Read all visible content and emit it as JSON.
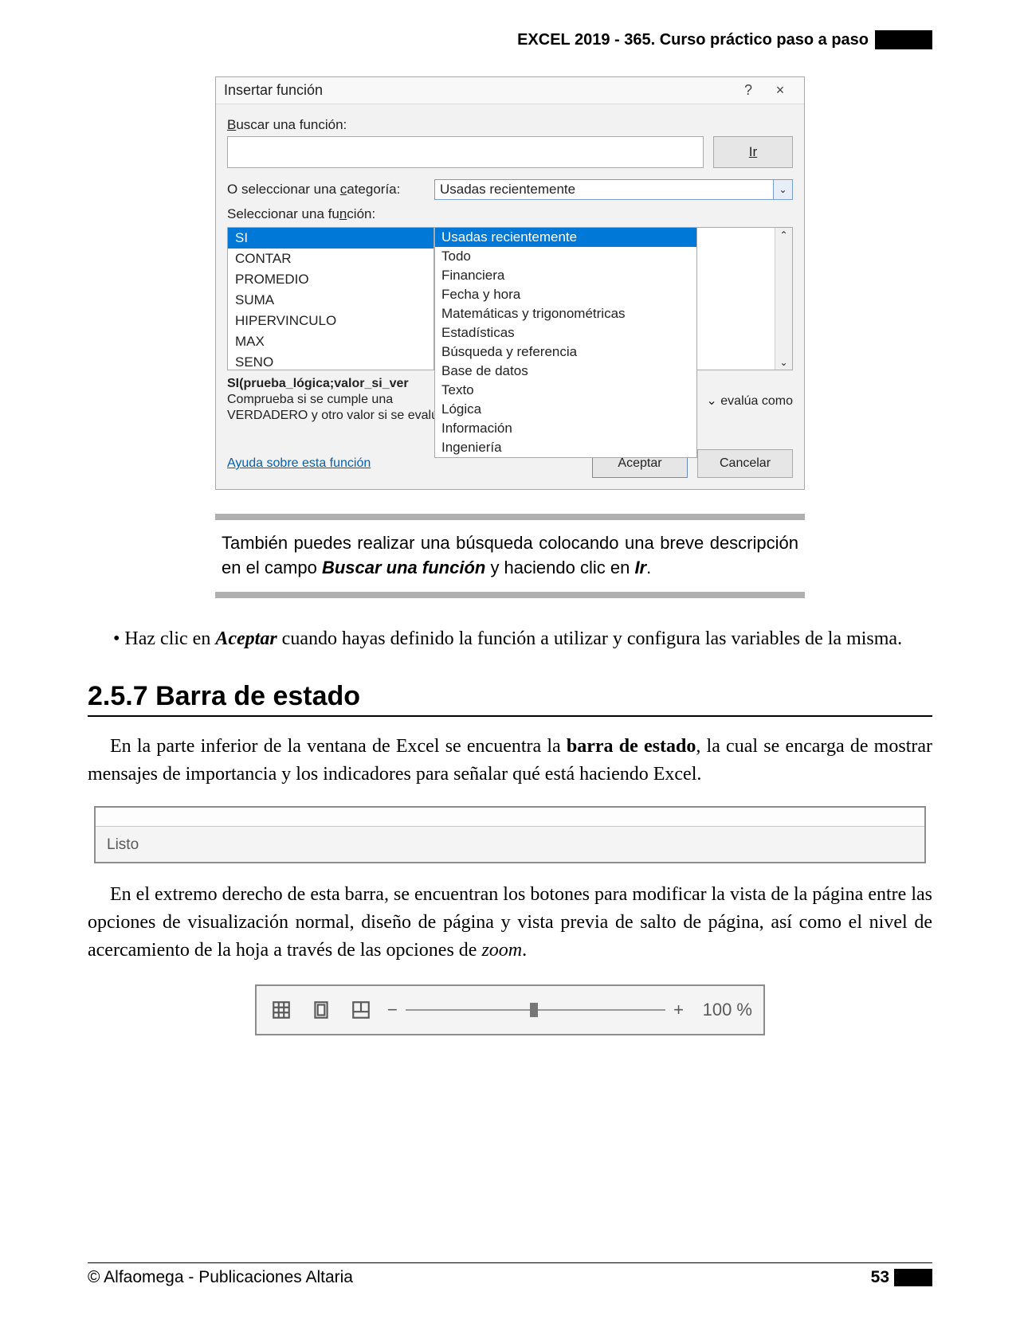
{
  "header": {
    "book_title": "EXCEL 2019 - 365. Curso práctico paso a paso"
  },
  "dialog": {
    "title": "Insertar función",
    "help_icon": "?",
    "close_icon": "×",
    "search_label": "Buscar una función:",
    "go_label": "Ir",
    "cat_label": "O seleccionar una categoría:",
    "cat_value": "Usadas recientemente",
    "dropdown_options": [
      "Usadas recientemente",
      "Todo",
      "Financiera",
      "Fecha y hora",
      "Matemáticas y trigonométricas",
      "Estadísticas",
      "Búsqueda y referencia",
      "Base de datos",
      "Texto",
      "Lógica",
      "Información",
      "Ingeniería"
    ],
    "func_label": "Seleccionar una función:",
    "func_list": [
      "SI",
      "CONTAR",
      "PROMEDIO",
      "SUMA",
      "HIPERVINCULO",
      "MAX",
      "SENO"
    ],
    "syntax": "SI(prueba_lógica;valor_si_ver",
    "desc_left": "Comprueba si se cumple una",
    "desc_right_trail": "evalúa como",
    "desc_line2": "VERDADERO y otro valor si se evalúa como FALSO.",
    "help_link": "Ayuda sobre esta función",
    "accept": "Aceptar",
    "cancel": "Cancelar"
  },
  "tip": {
    "t1": "También puedes realizar una búsqueda colocando una breve descripción en el campo ",
    "t_bold1": "Buscar una función",
    "t2": " y haciendo clic en ",
    "t_bold2": "Ir",
    "t3": "."
  },
  "bullet1": {
    "p1": "Haz clic en ",
    "b1": "Aceptar",
    "p2": " cuando hayas definido la función a utilizar y configura las variables de la misma."
  },
  "section_heading": "2.5.7 Barra de estado",
  "para1": {
    "p1": "En la parte inferior de la ventana de Excel se encuentra la ",
    "b1": "barra de estado",
    "p2": ", la cual se encarga de mostrar mensajes de importancia y los indicadores para señalar qué está haciendo Excel."
  },
  "statusbar": {
    "ready": "Listo"
  },
  "para2": {
    "p1": "En el extremo derecho de esta barra, se encuentran los botones para modificar la vista de la página entre las opciones de visualización normal, diseño de página y vista previa de salto de página, así como el nivel de acercamiento de la hoja a través de las opciones de ",
    "i1": "zoom",
    "p2": "."
  },
  "zoombar": {
    "minus": "−",
    "plus": "+",
    "pct": "100 %"
  },
  "footer": {
    "publisher": "© Alfaomega - Publicaciones Altaria",
    "page": "53"
  }
}
